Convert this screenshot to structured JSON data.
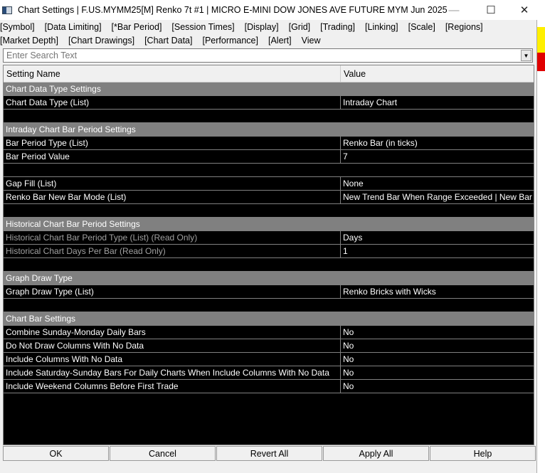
{
  "window": {
    "title": "Chart Settings | F.US.MYMM25[M]  Renko 7t #1 | MICRO E-MINI DOW JONES AVE FUTURE MYM Jun 2025",
    "minimize": "—",
    "maximize": "☐",
    "close": "✕"
  },
  "menu_row1": [
    "[Symbol]",
    "[Data Limiting]",
    "[*Bar Period]",
    "[Session Times]",
    "[Display]",
    "[Grid]",
    "[Trading]",
    "[Linking]",
    "[Scale]",
    "[Regions]"
  ],
  "menu_row2": [
    "[Market Depth]",
    "[Chart Drawings]",
    "[Chart Data]",
    "[Performance]",
    "[Alert]",
    "View"
  ],
  "search": {
    "placeholder": "Enter Search Text",
    "dropdown": "▼"
  },
  "columns": {
    "name": "Setting Name",
    "value": "Value"
  },
  "rows": [
    {
      "type": "section",
      "name": "Chart Data Type Settings"
    },
    {
      "type": "item",
      "name": "Chart Data Type (List)",
      "value": "Intraday Chart"
    },
    {
      "type": "blank"
    },
    {
      "type": "section",
      "name": "Intraday Chart Bar Period Settings"
    },
    {
      "type": "item",
      "name": "Bar Period Type (List)",
      "value": "Renko Bar (in ticks)"
    },
    {
      "type": "item",
      "name": "Bar Period Value",
      "value": "7"
    },
    {
      "type": "blank"
    },
    {
      "type": "item",
      "name": "Gap Fill (List)",
      "value": "None"
    },
    {
      "type": "item",
      "name": "Renko Bar New Bar Mode (List)",
      "value": "New Trend Bar When Range Exceeded | New Bar When Range Exceeded"
    },
    {
      "type": "blank"
    },
    {
      "type": "section",
      "name": "Historical Chart Bar Period Settings"
    },
    {
      "type": "readonly",
      "name": "Historical Chart Bar Period Type (List) (Read Only)",
      "value": "Days"
    },
    {
      "type": "readonly",
      "name": "Historical Chart Days Per Bar (Read Only)",
      "value": "1"
    },
    {
      "type": "blank"
    },
    {
      "type": "section",
      "name": "Graph Draw Type"
    },
    {
      "type": "item",
      "name": "Graph Draw Type (List)",
      "value": "Renko Bricks with Wicks"
    },
    {
      "type": "blank"
    },
    {
      "type": "section",
      "name": "Chart Bar Settings"
    },
    {
      "type": "item",
      "name": "Combine Sunday-Monday Daily Bars",
      "value": "No"
    },
    {
      "type": "item",
      "name": "Do Not Draw Columns With No Data",
      "value": "No"
    },
    {
      "type": "item",
      "name": "Include Columns With No Data",
      "value": "No"
    },
    {
      "type": "item",
      "name": "Include Saturday-Sunday Bars For Daily Charts When Include Columns With No Data",
      "value": "No"
    },
    {
      "type": "item",
      "name": "Include Weekend Columns Before First Trade",
      "value": "No"
    }
  ],
  "buttons": {
    "ok": "OK",
    "cancel": "Cancel",
    "revert": "Revert All",
    "apply": "Apply All",
    "help": "Help"
  }
}
